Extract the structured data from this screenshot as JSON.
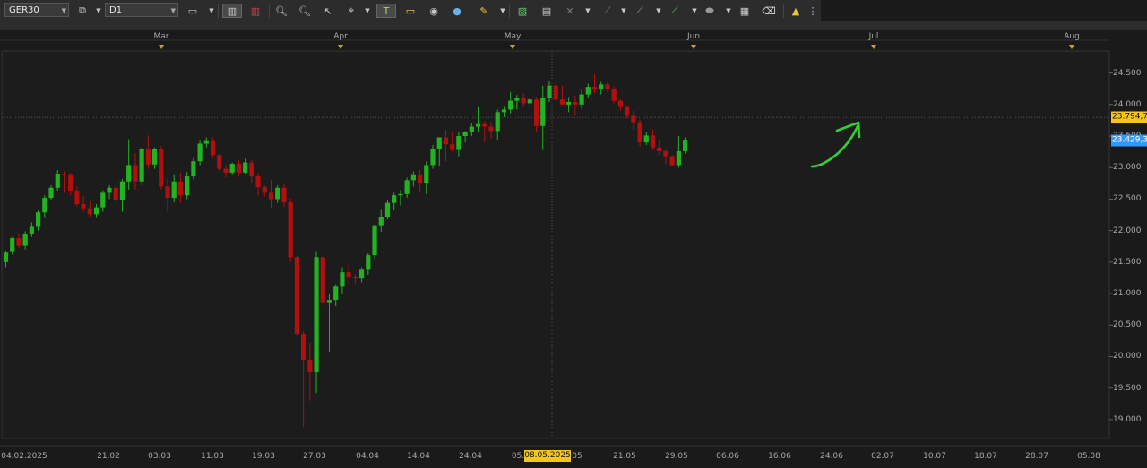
{
  "toolbar": {
    "symbol": "GER30",
    "timeframe": "D1",
    "icons": [
      "chart-type-icon",
      "dropdown-icon",
      "bar-chart-icon",
      "candles-icon",
      "zoom-in-icon",
      "zoom-out-icon",
      "cursor-icon",
      "crosshair-icon",
      "text-icon",
      "note-icon",
      "eye-icon",
      "globe-icon",
      "pencil-icon",
      "image-icon",
      "line-icon",
      "fibonacci-icon",
      "trend-icon",
      "shape-icon",
      "template-icon",
      "eraser-icon",
      "indicator-icon"
    ]
  },
  "colors": {
    "bull": "#22b322",
    "bear": "#b30f0f",
    "background": "#1a1a1a",
    "grid": "#2a2a2a",
    "current_price_tag": "#3399ff",
    "cursor_tag": "#f5c518",
    "arrow": "#2fd12f"
  },
  "chart_data": {
    "type": "candlestick",
    "symbol": "GER30",
    "timeframe": "D1",
    "ylim": [
      18700,
      24850
    ],
    "y_ticks": [
      "24.500",
      "24.000",
      "23.500",
      "23.000",
      "22.500",
      "22.000",
      "21.500",
      "21.000",
      "20.500",
      "20.000",
      "19.500",
      "19.000"
    ],
    "y_tick_values": [
      24500,
      24000,
      23500,
      23000,
      22500,
      22000,
      21500,
      21000,
      20500,
      20000,
      19500,
      19000
    ],
    "x_ticks": [
      "04.02.2025",
      "21.02",
      "03.03",
      "11.03",
      "19.03",
      "27.03",
      "04.04",
      "14.04",
      "24.04",
      "05.",
      "08.05.2025",
      "05",
      "21.05",
      "29.05",
      "06.06",
      "16.06",
      "24.06",
      "02.07",
      "10.07",
      "18.07",
      "28.07",
      "05.08"
    ],
    "month_markers": [
      "Mar",
      "Apr",
      "May",
      "Jun",
      "Jul",
      "Aug"
    ],
    "price_tags": [
      {
        "label": "23.794,7",
        "value": 23794.7,
        "color": "#f5c518"
      },
      {
        "label": "23.429,3",
        "value": 23429.3,
        "color": "#3399ff"
      }
    ],
    "cursor_date": "08.05.2025",
    "candles": [
      {
        "o": 21500,
        "h": 21680,
        "l": 21420,
        "c": 21650
      },
      {
        "o": 21660,
        "h": 21900,
        "l": 21620,
        "c": 21880
      },
      {
        "o": 21880,
        "h": 21960,
        "l": 21720,
        "c": 21760
      },
      {
        "o": 21760,
        "h": 21990,
        "l": 21700,
        "c": 21950
      },
      {
        "o": 21950,
        "h": 22130,
        "l": 21900,
        "c": 22060
      },
      {
        "o": 22060,
        "h": 22320,
        "l": 22000,
        "c": 22290
      },
      {
        "o": 22290,
        "h": 22560,
        "l": 22200,
        "c": 22520
      },
      {
        "o": 22520,
        "h": 22720,
        "l": 22480,
        "c": 22680
      },
      {
        "o": 22680,
        "h": 22960,
        "l": 22620,
        "c": 22900
      },
      {
        "o": 22900,
        "h": 22940,
        "l": 22600,
        "c": 22880
      },
      {
        "o": 22880,
        "h": 22920,
        "l": 22560,
        "c": 22620
      },
      {
        "o": 22620,
        "h": 22700,
        "l": 22380,
        "c": 22420
      },
      {
        "o": 22420,
        "h": 22550,
        "l": 22300,
        "c": 22340
      },
      {
        "o": 22340,
        "h": 22460,
        "l": 22220,
        "c": 22260
      },
      {
        "o": 22260,
        "h": 22420,
        "l": 22200,
        "c": 22370
      },
      {
        "o": 22370,
        "h": 22640,
        "l": 22300,
        "c": 22600
      },
      {
        "o": 22600,
        "h": 22720,
        "l": 22500,
        "c": 22680
      },
      {
        "o": 22680,
        "h": 22760,
        "l": 22420,
        "c": 22480
      },
      {
        "o": 22480,
        "h": 22820,
        "l": 22300,
        "c": 22780
      },
      {
        "o": 22780,
        "h": 23450,
        "l": 22650,
        "c": 23040
      },
      {
        "o": 23040,
        "h": 23230,
        "l": 22650,
        "c": 22780
      },
      {
        "o": 22780,
        "h": 23320,
        "l": 22720,
        "c": 23290
      },
      {
        "o": 23290,
        "h": 23510,
        "l": 22980,
        "c": 23050
      },
      {
        "o": 23050,
        "h": 23320,
        "l": 22980,
        "c": 23300
      },
      {
        "o": 23300,
        "h": 23340,
        "l": 22650,
        "c": 22700
      },
      {
        "o": 22700,
        "h": 22830,
        "l": 22300,
        "c": 22520
      },
      {
        "o": 22520,
        "h": 22880,
        "l": 22450,
        "c": 22780
      },
      {
        "o": 22780,
        "h": 22920,
        "l": 22440,
        "c": 22560
      },
      {
        "o": 22560,
        "h": 22930,
        "l": 22500,
        "c": 22860
      },
      {
        "o": 22860,
        "h": 23150,
        "l": 22810,
        "c": 23100
      },
      {
        "o": 23100,
        "h": 23440,
        "l": 23040,
        "c": 23380
      },
      {
        "o": 23380,
        "h": 23480,
        "l": 23320,
        "c": 23420
      },
      {
        "o": 23420,
        "h": 23480,
        "l": 23150,
        "c": 23200
      },
      {
        "o": 23200,
        "h": 23220,
        "l": 22940,
        "c": 22980
      },
      {
        "o": 22980,
        "h": 23040,
        "l": 22840,
        "c": 22920
      },
      {
        "o": 22920,
        "h": 23080,
        "l": 22880,
        "c": 23060
      },
      {
        "o": 23060,
        "h": 23120,
        "l": 22860,
        "c": 22920
      },
      {
        "o": 22920,
        "h": 23140,
        "l": 22900,
        "c": 23080
      },
      {
        "o": 23080,
        "h": 23120,
        "l": 22760,
        "c": 22860
      },
      {
        "o": 22860,
        "h": 22920,
        "l": 22560,
        "c": 22690
      },
      {
        "o": 22690,
        "h": 22720,
        "l": 22540,
        "c": 22600
      },
      {
        "o": 22600,
        "h": 22800,
        "l": 22360,
        "c": 22500
      },
      {
        "o": 22500,
        "h": 22720,
        "l": 22440,
        "c": 22680
      },
      {
        "o": 22680,
        "h": 22740,
        "l": 22380,
        "c": 22450
      },
      {
        "o": 22450,
        "h": 22510,
        "l": 21500,
        "c": 21580
      },
      {
        "o": 21580,
        "h": 21600,
        "l": 20340,
        "c": 20360
      },
      {
        "o": 20360,
        "h": 20400,
        "l": 18880,
        "c": 19950
      },
      {
        "o": 19950,
        "h": 20220,
        "l": 19300,
        "c": 19750
      },
      {
        "o": 19750,
        "h": 21660,
        "l": 19420,
        "c": 21580
      },
      {
        "o": 21580,
        "h": 21620,
        "l": 20780,
        "c": 20850
      },
      {
        "o": 20850,
        "h": 21000,
        "l": 20080,
        "c": 20900
      },
      {
        "o": 20900,
        "h": 21150,
        "l": 20800,
        "c": 21110
      },
      {
        "o": 21110,
        "h": 21420,
        "l": 21000,
        "c": 21340
      },
      {
        "o": 21340,
        "h": 21460,
        "l": 21140,
        "c": 21260
      },
      {
        "o": 21260,
        "h": 21310,
        "l": 21150,
        "c": 21240
      },
      {
        "o": 21240,
        "h": 21420,
        "l": 21180,
        "c": 21380
      },
      {
        "o": 21380,
        "h": 21640,
        "l": 21300,
        "c": 21610
      },
      {
        "o": 21610,
        "h": 22100,
        "l": 21550,
        "c": 22070
      },
      {
        "o": 22070,
        "h": 22330,
        "l": 21980,
        "c": 22220
      },
      {
        "o": 22220,
        "h": 22480,
        "l": 22180,
        "c": 22440
      },
      {
        "o": 22440,
        "h": 22600,
        "l": 22320,
        "c": 22560
      },
      {
        "o": 22560,
        "h": 22640,
        "l": 22400,
        "c": 22580
      },
      {
        "o": 22580,
        "h": 22840,
        "l": 22520,
        "c": 22800
      },
      {
        "o": 22800,
        "h": 22940,
        "l": 22700,
        "c": 22880
      },
      {
        "o": 22880,
        "h": 22960,
        "l": 22600,
        "c": 22760
      },
      {
        "o": 22760,
        "h": 23100,
        "l": 22580,
        "c": 23040
      },
      {
        "o": 23040,
        "h": 23360,
        "l": 22980,
        "c": 23290
      },
      {
        "o": 23290,
        "h": 23440,
        "l": 23020,
        "c": 23480
      },
      {
        "o": 23480,
        "h": 23600,
        "l": 23100,
        "c": 23370
      },
      {
        "o": 23370,
        "h": 23560,
        "l": 23250,
        "c": 23280
      },
      {
        "o": 23280,
        "h": 23560,
        "l": 23180,
        "c": 23500
      },
      {
        "o": 23500,
        "h": 23580,
        "l": 23400,
        "c": 23560
      },
      {
        "o": 23560,
        "h": 23700,
        "l": 23500,
        "c": 23650
      },
      {
        "o": 23650,
        "h": 23960,
        "l": 23560,
        "c": 23690
      },
      {
        "o": 23690,
        "h": 23740,
        "l": 23400,
        "c": 23650
      },
      {
        "o": 23650,
        "h": 23720,
        "l": 23460,
        "c": 23580
      },
      {
        "o": 23580,
        "h": 23920,
        "l": 23440,
        "c": 23880
      },
      {
        "o": 23880,
        "h": 23960,
        "l": 23800,
        "c": 23920
      },
      {
        "o": 23920,
        "h": 24200,
        "l": 23860,
        "c": 24060
      },
      {
        "o": 24060,
        "h": 24150,
        "l": 23920,
        "c": 24100
      },
      {
        "o": 24100,
        "h": 24180,
        "l": 23960,
        "c": 24020
      },
      {
        "o": 24020,
        "h": 24110,
        "l": 23980,
        "c": 24080
      },
      {
        "o": 24080,
        "h": 24120,
        "l": 23560,
        "c": 23660
      },
      {
        "o": 23660,
        "h": 24300,
        "l": 23280,
        "c": 24100
      },
      {
        "o": 24100,
        "h": 24370,
        "l": 24040,
        "c": 24300
      },
      {
        "o": 24300,
        "h": 24380,
        "l": 24060,
        "c": 24080
      },
      {
        "o": 24080,
        "h": 24300,
        "l": 24000,
        "c": 24000
      },
      {
        "o": 24000,
        "h": 24120,
        "l": 23880,
        "c": 24040
      },
      {
        "o": 24040,
        "h": 24140,
        "l": 23820,
        "c": 24000
      },
      {
        "o": 24000,
        "h": 24240,
        "l": 23930,
        "c": 24160
      },
      {
        "o": 24160,
        "h": 24330,
        "l": 24100,
        "c": 24280
      },
      {
        "o": 24280,
        "h": 24480,
        "l": 24180,
        "c": 24240
      },
      {
        "o": 24240,
        "h": 24360,
        "l": 24160,
        "c": 24320
      },
      {
        "o": 24320,
        "h": 24350,
        "l": 24200,
        "c": 24240
      },
      {
        "o": 24240,
        "h": 24290,
        "l": 24020,
        "c": 24060
      },
      {
        "o": 24060,
        "h": 24090,
        "l": 23900,
        "c": 23960
      },
      {
        "o": 23960,
        "h": 23980,
        "l": 23780,
        "c": 23820
      },
      {
        "o": 23820,
        "h": 23900,
        "l": 23600,
        "c": 23720
      },
      {
        "o": 23720,
        "h": 23760,
        "l": 23340,
        "c": 23400
      },
      {
        "o": 23400,
        "h": 23560,
        "l": 23360,
        "c": 23510
      },
      {
        "o": 23510,
        "h": 23600,
        "l": 23280,
        "c": 23320
      },
      {
        "o": 23320,
        "h": 23440,
        "l": 23200,
        "c": 23260
      },
      {
        "o": 23260,
        "h": 23290,
        "l": 23060,
        "c": 23180
      },
      {
        "o": 23180,
        "h": 23200,
        "l": 23020,
        "c": 23040
      },
      {
        "o": 23040,
        "h": 23500,
        "l": 23000,
        "c": 23260
      },
      {
        "o": 23260,
        "h": 23480,
        "l": 23220,
        "c": 23429
      }
    ]
  }
}
